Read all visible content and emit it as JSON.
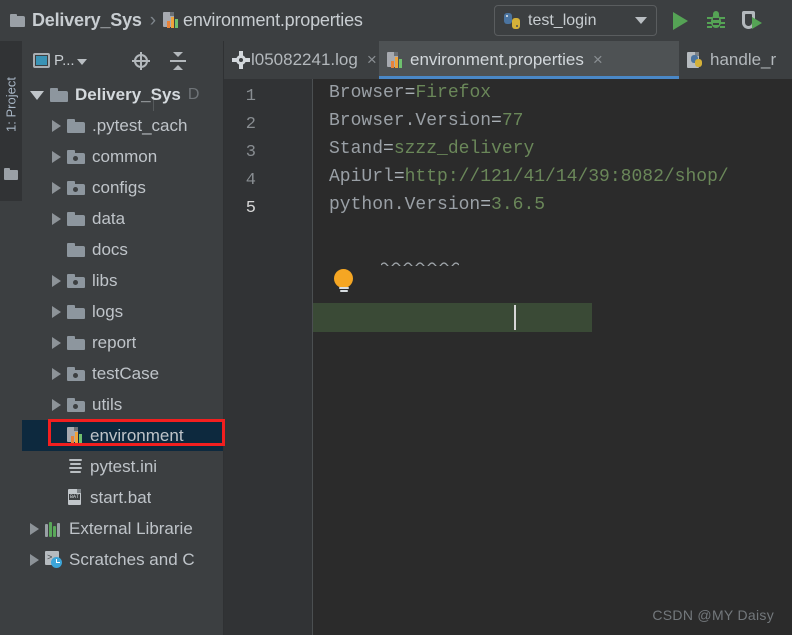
{
  "toolbar": {
    "breadcrumb_project": "Delivery_Sys",
    "breadcrumb_sep": "›",
    "breadcrumb_file": "environment.properties",
    "folder_icon": "folder-icon",
    "file_icon": "properties-file-icon",
    "run_config_label": "test_login",
    "run_config_icon": "python-icon",
    "dropdown_icon": "chevron-down-icon",
    "run_icon": "run-icon",
    "debug_icon": "debug-bug-icon",
    "coverage_icon": "run-with-coverage-icon"
  },
  "toolwindow_strip": {
    "label": "1: Project",
    "folder_icon": "folder-icon"
  },
  "project_panel": {
    "selector_label": "P...",
    "selector_icon": "project-view-icon",
    "selector_chevron": "chevron-down-icon",
    "locate_icon": "locate-in-tree-icon",
    "collapse_icon": "collapse-all-icon",
    "tree": [
      {
        "label": "Delivery_Sys",
        "path_hint": "D",
        "indent": 0,
        "arrow": "open",
        "icon": "folder-icon",
        "type": "root",
        "selected": false
      },
      {
        "label": ".pytest_cach",
        "path_hint": "",
        "indent": 1,
        "arrow": "closed",
        "icon": "folder-icon",
        "type": "folder",
        "selected": false
      },
      {
        "label": "common",
        "path_hint": "",
        "indent": 1,
        "arrow": "closed",
        "icon": "package-folder-icon",
        "type": "package",
        "selected": false
      },
      {
        "label": "configs",
        "path_hint": "",
        "indent": 1,
        "arrow": "closed",
        "icon": "package-folder-icon",
        "type": "package",
        "selected": false
      },
      {
        "label": "data",
        "path_hint": "",
        "indent": 1,
        "arrow": "closed",
        "icon": "folder-icon",
        "type": "folder",
        "selected": false
      },
      {
        "label": "docs",
        "path_hint": "",
        "indent": 1,
        "arrow": "none",
        "icon": "folder-icon",
        "type": "folder",
        "selected": false
      },
      {
        "label": "libs",
        "path_hint": "",
        "indent": 1,
        "arrow": "closed",
        "icon": "package-folder-icon",
        "type": "package",
        "selected": false
      },
      {
        "label": "logs",
        "path_hint": "",
        "indent": 1,
        "arrow": "closed",
        "icon": "folder-icon",
        "type": "folder",
        "selected": false
      },
      {
        "label": "report",
        "path_hint": "",
        "indent": 1,
        "arrow": "closed",
        "icon": "folder-icon",
        "type": "folder",
        "selected": false
      },
      {
        "label": "testCase",
        "path_hint": "",
        "indent": 1,
        "arrow": "closed",
        "icon": "package-folder-icon",
        "type": "package",
        "selected": false
      },
      {
        "label": "utils",
        "path_hint": "",
        "indent": 1,
        "arrow": "closed",
        "icon": "package-folder-icon",
        "type": "package",
        "selected": false
      },
      {
        "label": "environment",
        "path_hint": "",
        "indent": 1,
        "arrow": "none",
        "icon": "properties-file-icon",
        "type": "file",
        "selected": true
      },
      {
        "label": "pytest.ini",
        "path_hint": "",
        "indent": 1,
        "arrow": "none",
        "icon": "ini-file-icon",
        "type": "file",
        "selected": false
      },
      {
        "label": "start.bat",
        "path_hint": "",
        "indent": 1,
        "arrow": "none",
        "icon": "bat-file-icon",
        "type": "file",
        "selected": false
      },
      {
        "label": "External Librarie",
        "path_hint": "",
        "indent": 0,
        "arrow": "closed",
        "icon": "external-libraries-icon",
        "type": "node",
        "selected": false
      },
      {
        "label": "Scratches and C",
        "path_hint": "",
        "indent": 0,
        "arrow": "closed",
        "icon": "scratches-icon",
        "type": "node",
        "selected": false
      }
    ],
    "bat_icon_text": "BAT"
  },
  "editor": {
    "tabs": [
      {
        "label": "l05082241.log",
        "icon": "gear-icon",
        "active": false,
        "close": "×"
      },
      {
        "label": "environment.properties",
        "icon": "properties-file-icon",
        "active": true,
        "close": "×"
      },
      {
        "label": "handle_r",
        "icon": "python-file-icon",
        "active": false,
        "close": ""
      }
    ],
    "line_numbers": [
      "1",
      "2",
      "3",
      "4",
      "5"
    ],
    "current_line": 5,
    "lines": [
      {
        "key": "Browser",
        "eq": "=",
        "value": "Firefox"
      },
      {
        "key": "Browser.Version",
        "eq": "=",
        "value": "77"
      },
      {
        "key": "Stand",
        "eq": "=",
        "value": "szzz_delivery"
      },
      {
        "key": "ApiUrl",
        "eq": "=",
        "value": "http://121/41/14/39:8082/shop/"
      },
      {
        "key": "python.Version",
        "eq": "=",
        "value": "3.6.5"
      }
    ],
    "intention_bulb_icon": "lightbulb-icon"
  },
  "watermark": "CSDN @MY Daisy",
  "colors": {
    "editor_bg": "#2b2b2b",
    "panel_bg": "#3c3f41",
    "gutter_bg": "#313335",
    "tree_selection": "#0d293e",
    "tab_active_bg": "#4e5254",
    "tab_underline": "#4a88c7",
    "value_green": "#6a8759",
    "key_grey": "#9aa0a6",
    "annotation_red": "#f21f1f",
    "current_line_green": "#3a4a36",
    "run_green": "#55a355"
  }
}
